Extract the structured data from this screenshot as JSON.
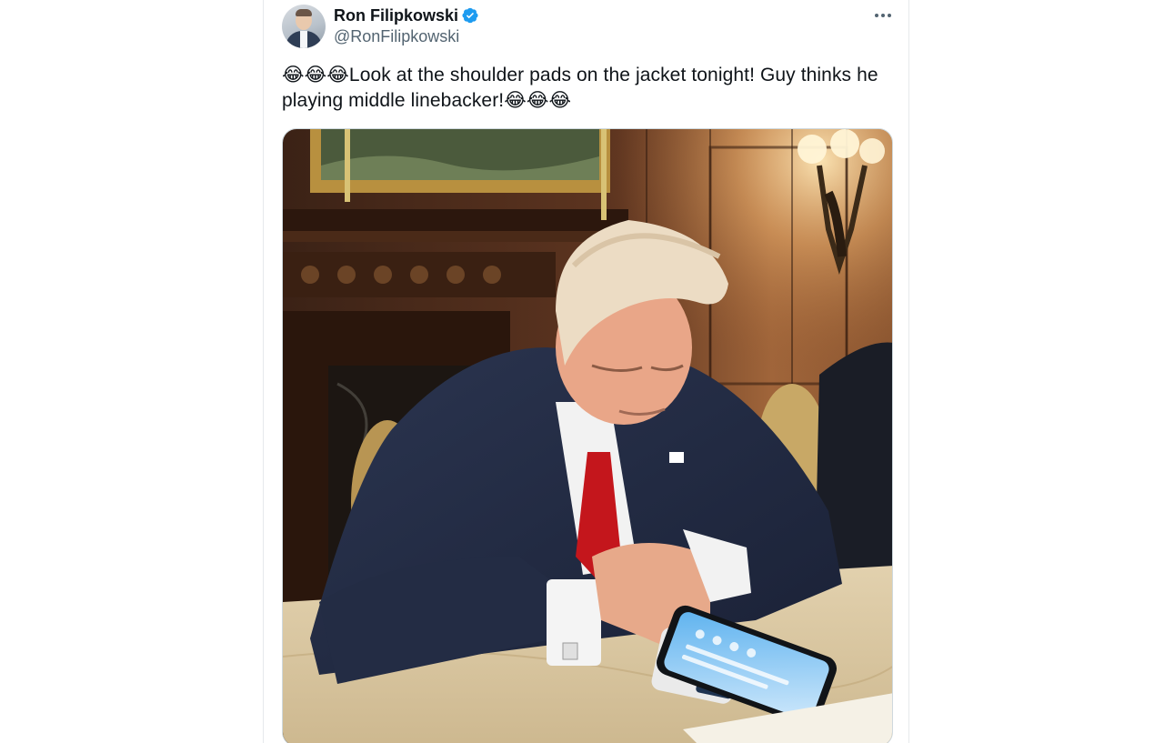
{
  "tweet": {
    "author": {
      "display_name": "Ron Filipkowski",
      "handle": "@RonFilipkowski",
      "verified": true
    },
    "text": "😂😂😂Look at the shoulder pads on the jacket tonight! Guy thinks he playing middle linebacker!😂😂😂",
    "media": {
      "type": "photo"
    }
  },
  "colors": {
    "text_primary": "#0f1419",
    "text_secondary": "#536471",
    "verified_badge": "#1d9bf0",
    "border": "#cfd9de"
  },
  "icons": {
    "verified": "verified-badge-icon",
    "more": "more-horizontal-icon"
  }
}
